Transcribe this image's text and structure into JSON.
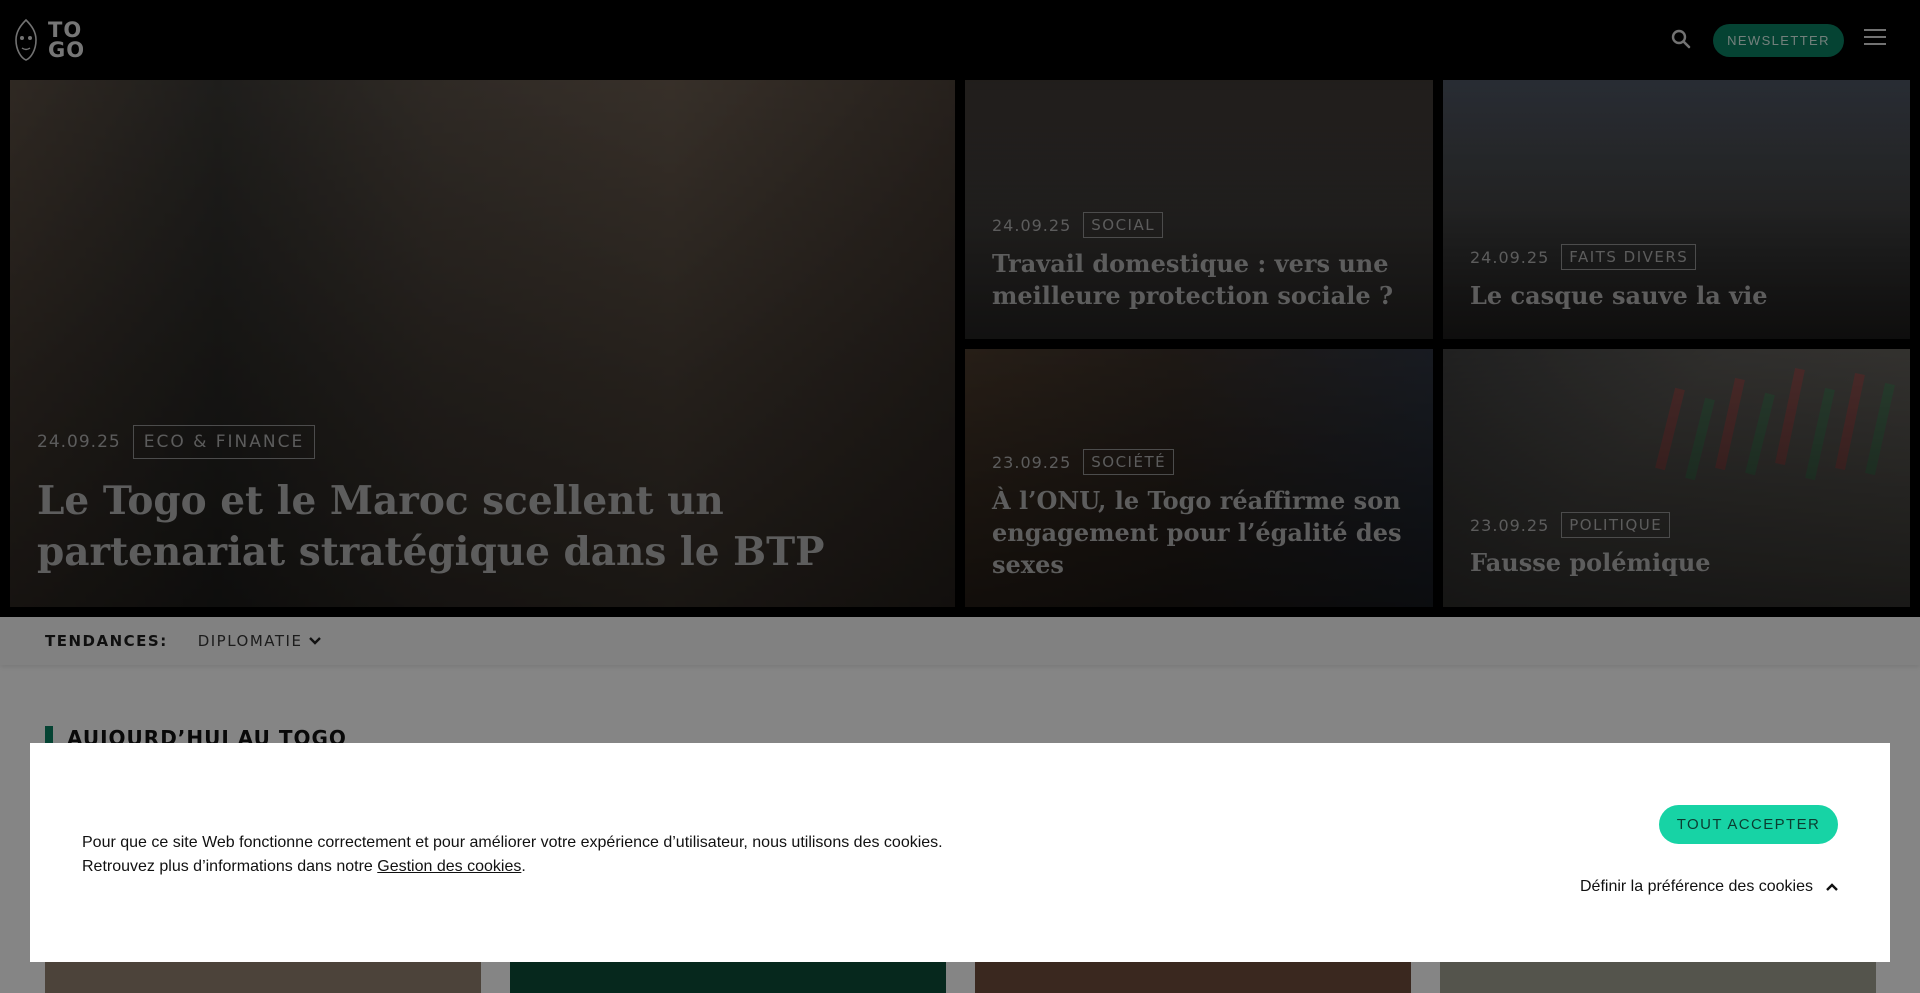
{
  "header": {
    "logo_text_line1": "TO",
    "logo_text_line2": "GO",
    "newsletter_label": "NEWSLETTER"
  },
  "hero": {
    "main": {
      "date": "24.09.25",
      "tag": "ECO & FINANCE",
      "title": "Le Togo et le Maroc scellent un partenariat stratégique dans le BTP"
    },
    "cards": [
      {
        "date": "24.09.25",
        "tag": "SOCIAL",
        "title": "Travail domestique : vers une meilleure protection sociale ?"
      },
      {
        "date": "24.09.25",
        "tag": "FAITS DIVERS",
        "title": "Le casque sauve la vie"
      },
      {
        "date": "23.09.25",
        "tag": "SOCIÉTÉ",
        "title": "À l’ONU, le Togo réaffirme son engagement pour l’égalité des sexes"
      },
      {
        "date": "23.09.25",
        "tag": "POLITIQUE",
        "title": "Fausse polémique"
      }
    ]
  },
  "trends": {
    "label": "TENDANCES:",
    "item": "DIPLOMATIE"
  },
  "section": {
    "heading": "AUJOURD’HUI AU TOGO"
  },
  "cookie": {
    "text_line1": "Pour que ce site Web fonctionne correctement et pour améliorer votre expérience d’utilisateur, nous utilisons des cookies.",
    "text_line2_prefix": "Retrouvez plus d’informations dans notre ",
    "link_label": "Gestion des cookies",
    "text_line2_suffix": ".",
    "accept_label": "TOUT ACCEPTER",
    "preference_label": "Définir la préférence des cookies"
  },
  "colors": {
    "brand_green": "#0a7a5e",
    "accept_green": "#17d3a5"
  },
  "icons": [
    "mask-logo-icon",
    "search-icon",
    "menu-icon",
    "chevron-down-icon",
    "chevron-up-icon"
  ]
}
